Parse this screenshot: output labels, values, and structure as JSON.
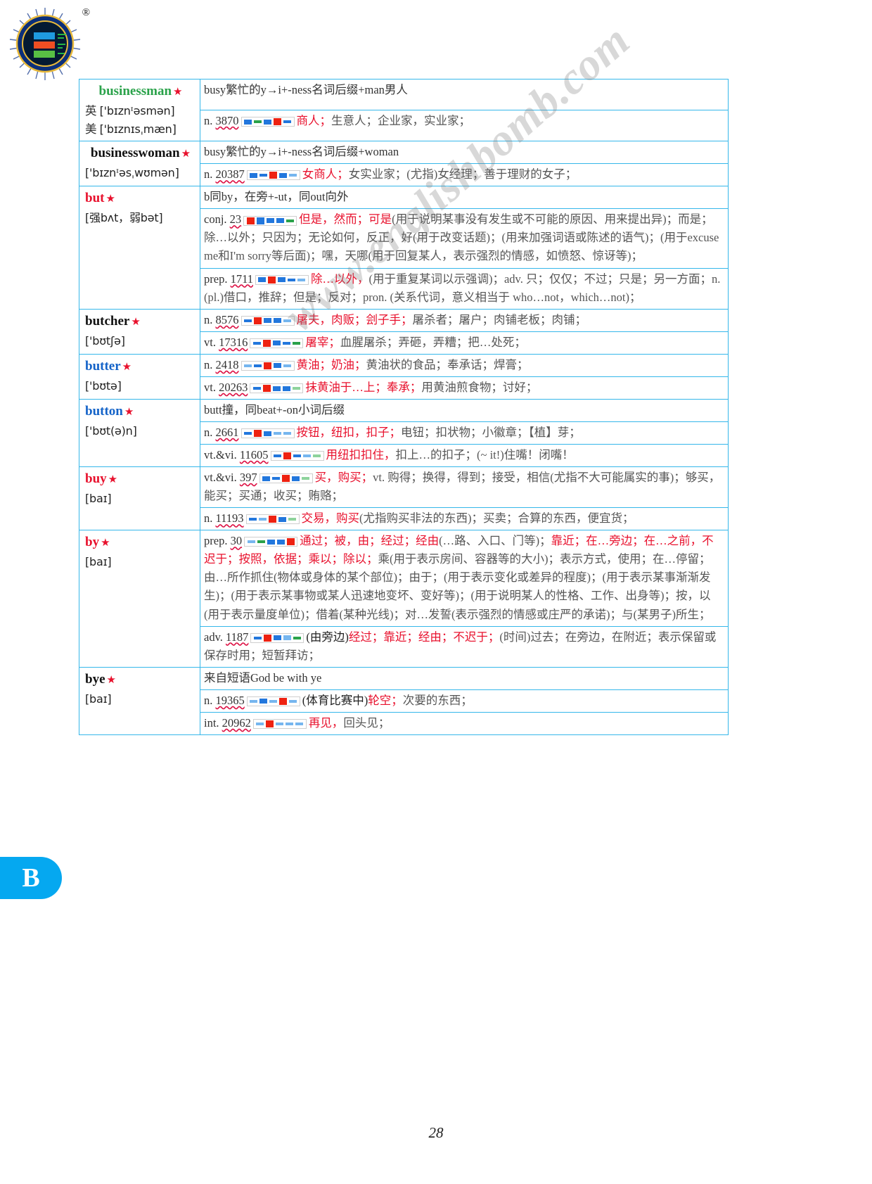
{
  "brand": {
    "registered_mark": "®",
    "logo_name": "yingbao-education-logo"
  },
  "watermark": {
    "text": "www.englishbomb.com"
  },
  "letter_tab": {
    "label": "B"
  },
  "page": {
    "number": "28"
  },
  "entries": [
    {
      "id": "businessman",
      "headword": "businessman",
      "headword_color": "#2aa24a",
      "starred": true,
      "pron": [
        {
          "label": "英",
          "ipa": "['bɪznᶦəsmən]"
        },
        {
          "label": "美",
          "ipa": "['bɪznɪsˌmæn]"
        }
      ],
      "etymology": "busy繁忙的y→i+-ness名词后缀+man男人",
      "senses": [
        {
          "pos": "n.",
          "rank": "3870",
          "bars": [
            "b2 lv-blue",
            "b1 lv-green",
            "b2 lv-blue",
            "b3 lv-red",
            "b1 lv-blue"
          ],
          "red": "商人；",
          "rest": "生意人；企业家，实业家；"
        }
      ]
    },
    {
      "id": "businesswoman",
      "headword": "businesswoman",
      "headword_color": "#111111",
      "starred": true,
      "pron": [
        {
          "label": "",
          "ipa": "['bɪznᶦəsˌwʊmən]"
        }
      ],
      "etymology": "busy繁忙的y→i+-ness名词后缀+woman",
      "senses": [
        {
          "pos": "n.",
          "rank": "20387",
          "bars": [
            "b2 lv-blue",
            "b1 lv-blue",
            "b3 lv-red",
            "b2 lv-blue",
            "b1 lv-lblue"
          ],
          "red": "女商人；",
          "rest": "女实业家；(尤指)女经理；善于理财的女子；"
        }
      ]
    },
    {
      "id": "but",
      "headword": "but",
      "headword_color": "#e8112d",
      "starred": true,
      "pron": [
        {
          "label": "",
          "ipa": "[强bʌt，弱bət]"
        }
      ],
      "etymology": "b同by，在旁+-ut，同out向外",
      "senses": [
        {
          "pos": "conj.",
          "rank": "23",
          "bars": [
            "b3 lv-red",
            "b3 lv-blue",
            "b2 lv-blue",
            "b2 lv-blue",
            "b1 lv-green"
          ],
          "red": "但是，然而；可是",
          "rest": "(用于说明某事没有发生或不可能的原因、用来提出异)；而是；除…以外；只因为；无论如何，反正，好(用于改变话题)；(用来加强词语或陈述的语气)；(用于excuse me和I'm sorry等后面)；嘿，天哪(用于回复某人，表示强烈的情感，如愤怒、惊讶等)；"
        },
        {
          "pos": "prep.",
          "rank": "1711",
          "bars": [
            "b2 lv-blue",
            "b3 lv-red",
            "b2 lv-blue",
            "b1 lv-blue",
            "b1 lv-lblue"
          ],
          "red": "除…以外，",
          "rest": "(用于重复某词以示强调)；adv. 只；仅仅；不过；只是；另一方面；n. (pl.)借口，推辞；但是；反对；pron. (关系代词，意义相当于 who…not，which…not)；"
        }
      ]
    },
    {
      "id": "butcher",
      "headword": "butcher",
      "headword_color": "#111111",
      "starred": true,
      "pron": [
        {
          "label": "",
          "ipa": "['bʊtʃə]"
        }
      ],
      "etymology": null,
      "senses": [
        {
          "pos": "n.",
          "rank": "8576",
          "bars": [
            "b1 lv-blue",
            "b3 lv-red",
            "b2 lv-blue",
            "b2 lv-blue",
            "b1 lv-lblue"
          ],
          "red": "屠夫，肉贩；刽子手；",
          "rest": "屠杀者；屠户；肉铺老板；肉铺；"
        },
        {
          "pos": "vt.",
          "rank": "17316",
          "bars": [
            "b1 lv-blue",
            "b3 lv-red",
            "b2 lv-blue",
            "b1 lv-blue",
            "b1 lv-green"
          ],
          "red": "屠宰；",
          "rest": "血腥屠杀；弄砸，弄糟；把…处死；"
        }
      ]
    },
    {
      "id": "butter",
      "headword": "butter",
      "headword_color": "#1463c8",
      "starred": true,
      "pron": [
        {
          "label": "",
          "ipa": "['bʊtə]"
        }
      ],
      "etymology": null,
      "senses": [
        {
          "pos": "n.",
          "rank": "2418",
          "bars": [
            "b1 lv-lblue",
            "b1 lv-blue",
            "b3 lv-red",
            "b2 lv-blue",
            "b1 lv-lblue"
          ],
          "red": "黄油；奶油；",
          "rest": "黄油状的食品；奉承话；焊膏；"
        },
        {
          "pos": "vt.",
          "rank": "20263",
          "bars": [
            "b1 lv-blue",
            "b3 lv-red",
            "b2 lv-blue",
            "b2 lv-blue",
            "b1 lv-lgreen"
          ],
          "red": "抹黄油于…上；奉承；",
          "rest": "用黄油煎食物；讨好；"
        }
      ]
    },
    {
      "id": "button",
      "headword": "button",
      "headword_color": "#1463c8",
      "starred": true,
      "pron": [
        {
          "label": "",
          "ipa": "['bʊt(ə)n]"
        }
      ],
      "etymology": "butt撞，同beat+-on小词后缀",
      "senses": [
        {
          "pos": "n.",
          "rank": "2661",
          "bars": [
            "b1 lv-blue",
            "b3 lv-red",
            "b2 lv-blue",
            "b1 lv-lblue",
            "b1 lv-lblue"
          ],
          "red": "按钮，纽扣，扣子；",
          "rest": "电钮；扣状物；小徽章；【植】芽；"
        },
        {
          "pos": "vt.&vi.",
          "rank": "11605",
          "bars": [
            "b1 lv-blue",
            "b3 lv-red",
            "b1 lv-blue",
            "b1 lv-lblue",
            "b1 lv-lgreen"
          ],
          "red": "用纽扣扣住，",
          "rest": "扣上…的扣子；(~ it!)住嘴！闭嘴！",
          "red_light": true
        }
      ]
    },
    {
      "id": "buy",
      "headword": "buy",
      "headword_color": "#e8112d",
      "starred": true,
      "pron": [
        {
          "label": "",
          "ipa": "[baɪ]"
        }
      ],
      "etymology": null,
      "senses": [
        {
          "pos": "vt.&vi.",
          "rank": "397",
          "bars": [
            "b2 lv-blue",
            "b1 lv-blue",
            "b3 lv-red",
            "b2 lv-blue",
            "b1 lv-lgreen"
          ],
          "red": "买，购买；",
          "rest": "vt. 购得；换得，得到；接受，相信(尤指不大可能属实的事)；够买，能买；买通；收买；贿赂；"
        },
        {
          "pos": "n.",
          "rank": "11193",
          "bars": [
            "b1 lv-blue",
            "b1 lv-lblue",
            "b3 lv-red",
            "b2 lv-blue",
            "b1 lv-lgreen"
          ],
          "red": "交易，购买",
          "rest": "(尤指购买非法的东西)；买卖；合算的东西，便宜货；"
        }
      ]
    },
    {
      "id": "by",
      "headword": "by",
      "headword_color": "#e8112d",
      "starred": true,
      "pron": [
        {
          "label": "",
          "ipa": "[baɪ]"
        }
      ],
      "etymology": null,
      "senses": [
        {
          "pos": "prep.",
          "rank": "30",
          "bars": [
            "b1 lv-lblue",
            "b1 lv-green",
            "b2 lv-blue",
            "b2 lv-blue",
            "b3 lv-red"
          ],
          "red": "通过；被，由；经过；经由",
          "rest": "(…路、入口、门等)；",
          "red2": "靠近；在…旁边；在…之前，不迟于；按照，依据；乘以；除以；",
          "rest2": "乘(用于表示房间、容器等的大小)；表示方式，使用；在…停留；由…所作抓住(物体或身体的某个部位)；由于；(用于表示变化或差异的程度)；(用于表示某事渐渐发生)；(用于表示某事物或某人迅速地变坏、变好等)；(用于说明某人的性格、工作、出身等)；按，以(用于表示量度单位)；借着(某种光线)；对…发誓(表示强烈的情感或庄严的承诺)；与(某男子)所生；"
        },
        {
          "pos": "adv.",
          "rank": "1187",
          "bars": [
            "b1 lv-blue",
            "b3 lv-red",
            "b2 lv-blue",
            "b2 lv-lblue",
            "b1 lv-green"
          ],
          "pre": "(由旁边)",
          "red": "经过；靠近；经由；不迟于；",
          "rest": "(时间)过去；在旁边，在附近；表示保留或保存时用；短暂拜访；"
        }
      ]
    },
    {
      "id": "bye",
      "headword": "bye",
      "headword_color": "#111111",
      "starred": true,
      "pron": [
        {
          "label": "",
          "ipa": "[baɪ]"
        }
      ],
      "etymology": "来自短语God be with ye",
      "senses": [
        {
          "pos": "n.",
          "rank": "19365",
          "bars": [
            "b1 lv-lblue",
            "b2 lv-blue",
            "b1 lv-lblue",
            "b3 lv-red",
            "b1 lv-lblue"
          ],
          "pre": "(体育比赛中)",
          "red": "轮空；",
          "rest": "次要的东西；"
        },
        {
          "pos": "int.",
          "rank": "20962",
          "bars": [
            "b1 lv-lblue",
            "b3 lv-red",
            "b1 lv-lblue",
            "b1 lv-lblue",
            "b1 lv-lblue"
          ],
          "red": "再见，",
          "rest": "回头见；"
        }
      ]
    }
  ]
}
